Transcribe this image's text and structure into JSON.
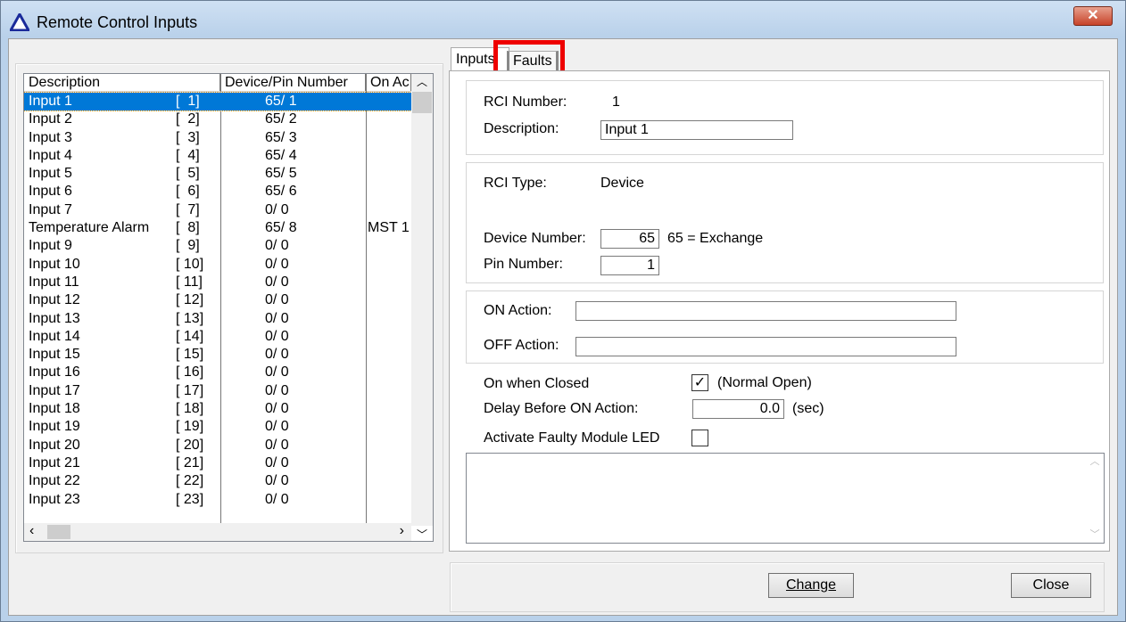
{
  "window": {
    "title": "Remote Control Inputs",
    "close": "✕"
  },
  "list": {
    "headers": [
      "Description",
      "Device/Pin Number",
      "On Ac"
    ],
    "rows": [
      {
        "desc": "Input 1",
        "num": "[  1]",
        "dp": "65/ 1",
        "on": ""
      },
      {
        "desc": "Input 2",
        "num": "[  2]",
        "dp": "65/ 2",
        "on": ""
      },
      {
        "desc": "Input 3",
        "num": "[  3]",
        "dp": "65/ 3",
        "on": ""
      },
      {
        "desc": "Input 4",
        "num": "[  4]",
        "dp": "65/ 4",
        "on": ""
      },
      {
        "desc": "Input 5",
        "num": "[  5]",
        "dp": "65/ 5",
        "on": ""
      },
      {
        "desc": "Input 6",
        "num": "[  6]",
        "dp": "65/ 6",
        "on": ""
      },
      {
        "desc": "Input 7",
        "num": "[  7]",
        "dp": "0/ 0",
        "on": ""
      },
      {
        "desc": "Temperature Alarm",
        "num": "[  8]",
        "dp": "65/ 8",
        "on": "MST 1"
      },
      {
        "desc": "Input 9",
        "num": "[  9]",
        "dp": "0/ 0",
        "on": ""
      },
      {
        "desc": "Input 10",
        "num": "[ 10]",
        "dp": "0/ 0",
        "on": ""
      },
      {
        "desc": "Input 11",
        "num": "[ 11]",
        "dp": "0/ 0",
        "on": ""
      },
      {
        "desc": "Input 12",
        "num": "[ 12]",
        "dp": "0/ 0",
        "on": ""
      },
      {
        "desc": "Input 13",
        "num": "[ 13]",
        "dp": "0/ 0",
        "on": ""
      },
      {
        "desc": "Input 14",
        "num": "[ 14]",
        "dp": "0/ 0",
        "on": ""
      },
      {
        "desc": "Input 15",
        "num": "[ 15]",
        "dp": "0/ 0",
        "on": ""
      },
      {
        "desc": "Input 16",
        "num": "[ 16]",
        "dp": "0/ 0",
        "on": ""
      },
      {
        "desc": "Input 17",
        "num": "[ 17]",
        "dp": "0/ 0",
        "on": ""
      },
      {
        "desc": "Input 18",
        "num": "[ 18]",
        "dp": "0/ 0",
        "on": ""
      },
      {
        "desc": "Input 19",
        "num": "[ 19]",
        "dp": "0/ 0",
        "on": ""
      },
      {
        "desc": "Input 20",
        "num": "[ 20]",
        "dp": "0/ 0",
        "on": ""
      },
      {
        "desc": "Input 21",
        "num": "[ 21]",
        "dp": "0/ 0",
        "on": ""
      },
      {
        "desc": "Input 22",
        "num": "[ 22]",
        "dp": "0/ 0",
        "on": ""
      },
      {
        "desc": "Input 23",
        "num": "[ 23]",
        "dp": "0/ 0",
        "on": ""
      }
    ]
  },
  "tabs": [
    "Inputs",
    "Faults"
  ],
  "form": {
    "rci_number_label": "RCI Number:",
    "rci_number": "1",
    "description_label": "Description:",
    "description": "Input 1",
    "rci_type_label": "RCI Type:",
    "rci_type": "Device",
    "device_number_label": "Device Number:",
    "device_number": "65",
    "device_note": "65 = Exchange",
    "pin_number_label": "Pin Number:",
    "pin_number": "1",
    "on_action_label": "ON Action:",
    "on_action": "",
    "off_action_label": "OFF Action:",
    "off_action": "",
    "on_when_closed_label": "On when Closed",
    "on_when_closed_checked": true,
    "normal_open": "(Normal Open)",
    "delay_label": "Delay Before ON Action:",
    "delay": "0.0",
    "sec": "(sec)",
    "faulty_led_label": "Activate Faulty Module LED",
    "faulty_led_checked": false
  },
  "buttons": {
    "change": "Change",
    "close": "Close"
  }
}
